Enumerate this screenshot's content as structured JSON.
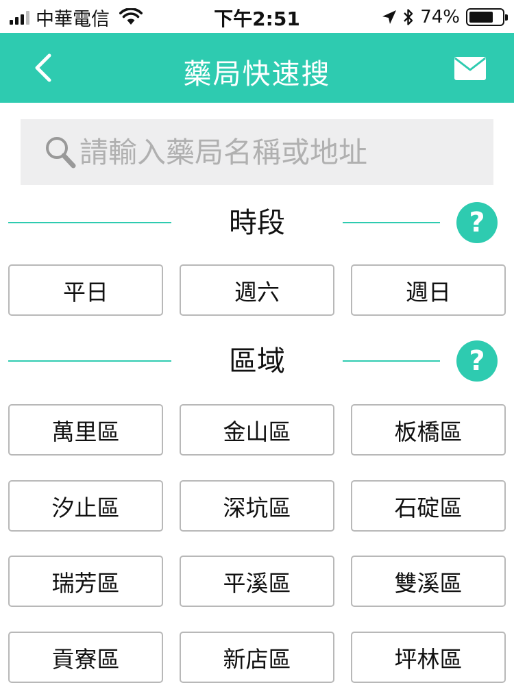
{
  "status_bar": {
    "carrier": "中華電信",
    "time": "下午2:51",
    "battery_percent": "74%",
    "battery_level": 0.74,
    "signal_bars_filled": 3,
    "signal_bars_total": 4
  },
  "nav": {
    "title": "藥局快速搜",
    "back_icon": "chevron-left-icon",
    "mail_icon": "envelope-icon"
  },
  "search": {
    "placeholder": "請輸入藥局名稱或地址",
    "value": ""
  },
  "time_section": {
    "title": "時段",
    "help": "?",
    "options": [
      "平日",
      "週六",
      "週日"
    ]
  },
  "area_section": {
    "title": "區域",
    "help": "?",
    "options": [
      "萬里區",
      "金山區",
      "板橋區",
      "汐止區",
      "深坑區",
      "石碇區",
      "瑞芳區",
      "平溪區",
      "雙溪區",
      "貢寮區",
      "新店區",
      "坪林區"
    ]
  },
  "colors": {
    "accent": "#2ecbb0",
    "search_bg": "#eeeeef",
    "button_border": "#b8b8b8"
  }
}
